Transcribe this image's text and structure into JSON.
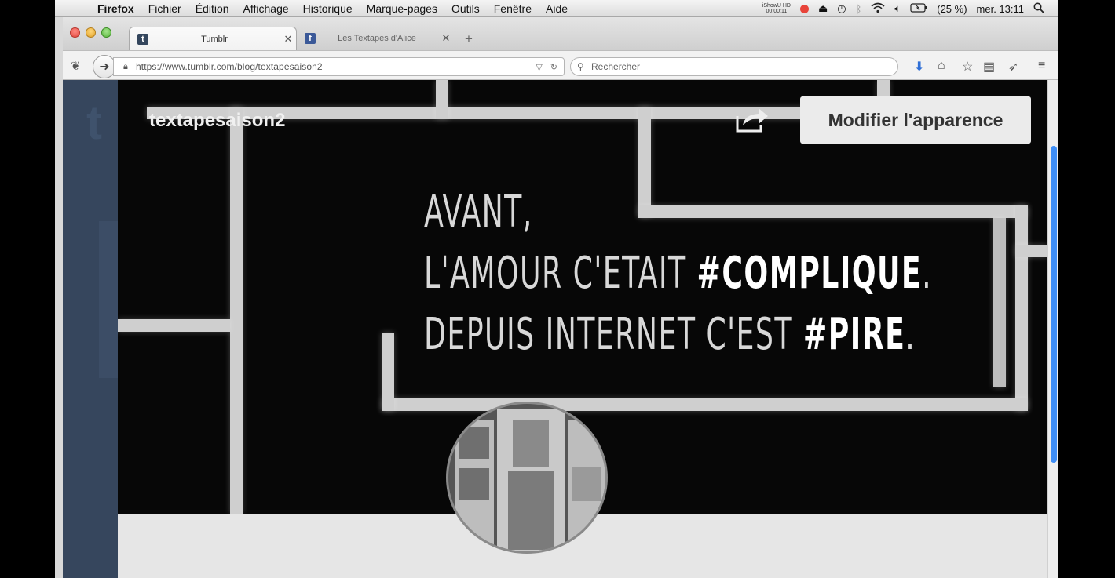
{
  "menubar": {
    "apple": "",
    "app_name": "Firefox",
    "items": [
      "Fichier",
      "Édition",
      "Affichage",
      "Historique",
      "Marque-pages",
      "Outils",
      "Fenêtre",
      "Aide"
    ],
    "recorder_line1": "iShowU HD",
    "recorder_line2": "00:00:11",
    "battery": "(25 %)",
    "clock": "mer. 13:11"
  },
  "tabs": [
    {
      "title": "Tumblr",
      "favicon": "t"
    },
    {
      "title": "Les Textapes d'Alice",
      "favicon": "f"
    }
  ],
  "navbar": {
    "url": "https://www.tumblr.com/blog/textapesaison2",
    "search_placeholder": "Rechercher"
  },
  "page": {
    "blog_name": "textapesaison2",
    "customize_label": "Modifier l'apparence",
    "quote": {
      "line1": "AVANT,",
      "line2_pre": "L'AMOUR C'ETAIT ",
      "line2_hash": "#COMPLIQUE",
      "line2_post": ".",
      "line3_pre": "DEPUIS INTERNET C'EST ",
      "line3_hash": "#PIRE",
      "line3_post": "."
    }
  },
  "colors": {
    "tumblr_blue": "#36465d",
    "scroll_thumb": "#3e8ef7",
    "header_bg": "#070707"
  }
}
